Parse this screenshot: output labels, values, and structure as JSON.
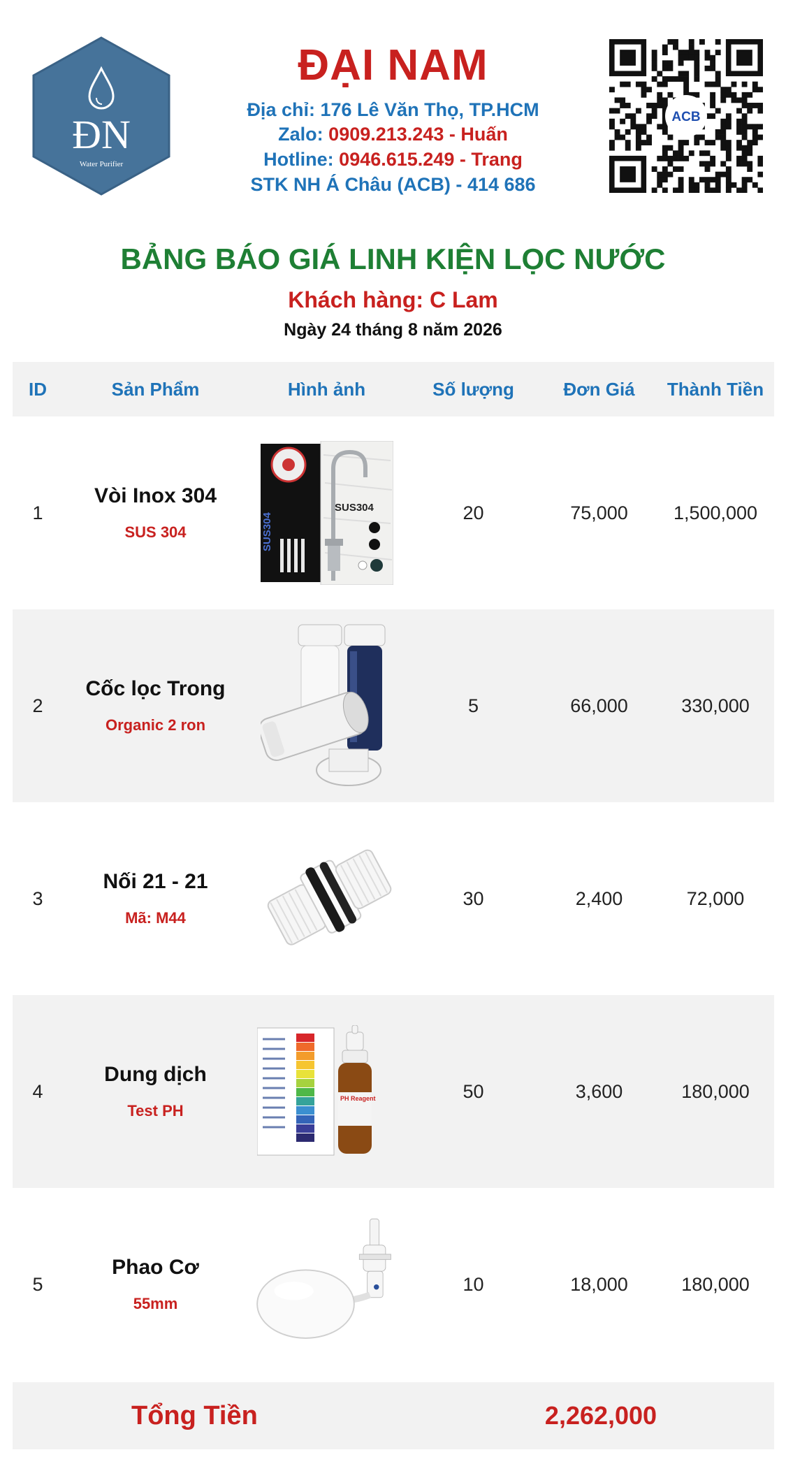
{
  "header": {
    "company": "ĐẠI NAM",
    "logo_text": "ĐN",
    "logo_subtext": "Water Purifier",
    "address_label": "Địa chỉ:",
    "address_value": "176 Lê Văn Thọ, TP.HCM",
    "zalo_label": "Zalo:",
    "zalo_value": "0909.213.243 - Huấn",
    "hotline_label": "Hotline:",
    "hotline_value": "0946.615.249 - Trang",
    "bank_label": "STK NH Á Châu (ACB) -",
    "bank_value": "414 686",
    "qr_badge": "ACB"
  },
  "document": {
    "title": "BẢNG BÁO GIÁ LINH KIỆN LỌC NƯỚC",
    "customer": "Khách hàng: C Lam",
    "date": "Ngày 24 tháng 8 năm 2026"
  },
  "table": {
    "headers": [
      "ID",
      "Sản Phẩm",
      "Hình ảnh",
      "Số lượng",
      "Đơn Giá",
      "Thành Tiền"
    ],
    "rows": [
      {
        "id": "1",
        "name": "Vòi Inox 304",
        "sub": "SUS 304",
        "qty": "20",
        "price": "75,000",
        "total": "1,500,000",
        "image_icon": "faucet-image",
        "image_text": "SUS304"
      },
      {
        "id": "2",
        "name": "Cốc lọc Trong",
        "sub": "Organic 2 ron",
        "qty": "5",
        "price": "66,000",
        "total": "330,000",
        "image_icon": "filter-housing-image"
      },
      {
        "id": "3",
        "name": "Nối 21 - 21",
        "sub": "Mã: M44",
        "qty": "30",
        "price": "2,400",
        "total": "72,000",
        "image_icon": "pipe-connector-image"
      },
      {
        "id": "4",
        "name": "Dung dịch",
        "sub": "Test PH",
        "qty": "50",
        "price": "3,600",
        "total": "180,000",
        "image_icon": "ph-test-kit-image",
        "image_text": "PH Reagent"
      },
      {
        "id": "5",
        "name": "Phao Cơ",
        "sub": "55mm",
        "qty": "10",
        "price": "18,000",
        "total": "180,000",
        "image_icon": "float-valve-image"
      }
    ],
    "total_label": "Tổng Tiền",
    "total_value": "2,262,000"
  },
  "colors": {
    "red": "#c8211f",
    "blue": "#1f73b8",
    "green": "#1e7f34",
    "row_shade": "#f2f2f2",
    "logo_bg": "#46739a"
  }
}
